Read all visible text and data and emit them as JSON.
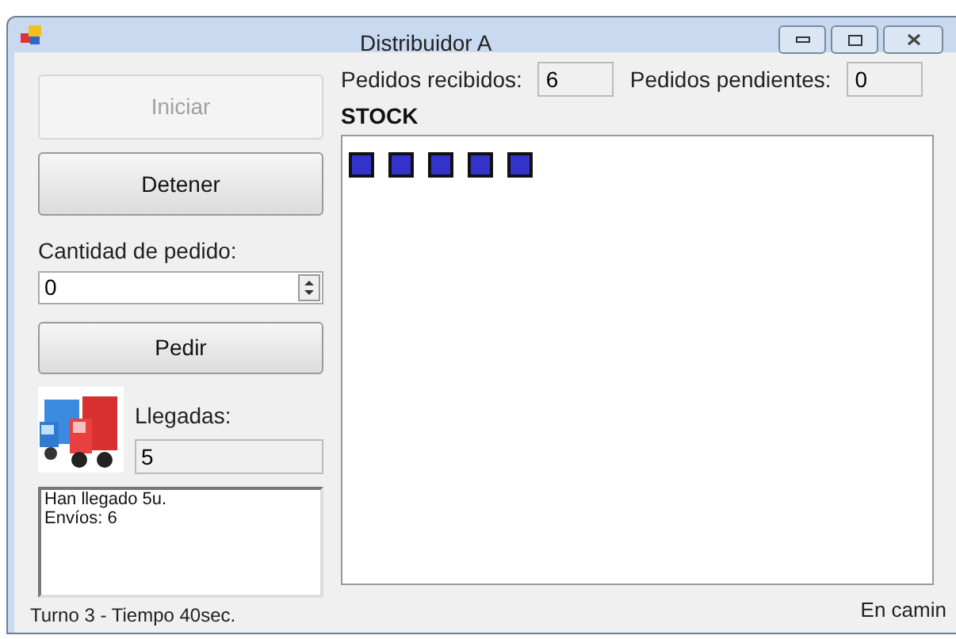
{
  "window": {
    "title": "Distribuidor A"
  },
  "controls": {
    "start_button": {
      "label": "Iniciar",
      "disabled": true
    },
    "stop_button": {
      "label": "Detener",
      "disabled": false
    },
    "quantity_label": "Cantidad de pedido:",
    "quantity_value": "0",
    "order_button": {
      "label": "Pedir",
      "disabled": false
    }
  },
  "arrivals": {
    "label": "Llegadas:",
    "value": "5"
  },
  "log": [
    "Han llegado 5u.",
    "Envíos: 6"
  ],
  "orders": {
    "received_label": "Pedidos recibidos:",
    "received_value": "6",
    "pending_label": "Pedidos pendientes:",
    "pending_value": "0"
  },
  "stock": {
    "title": "STOCK",
    "units": [
      {
        "kind": "box"
      },
      {
        "kind": "box"
      },
      {
        "kind": "box"
      },
      {
        "kind": "box"
      },
      {
        "kind": "box"
      }
    ]
  },
  "status_bar": {
    "left": "Turno 3 - Tiempo 40sec.",
    "right": "En camin"
  }
}
